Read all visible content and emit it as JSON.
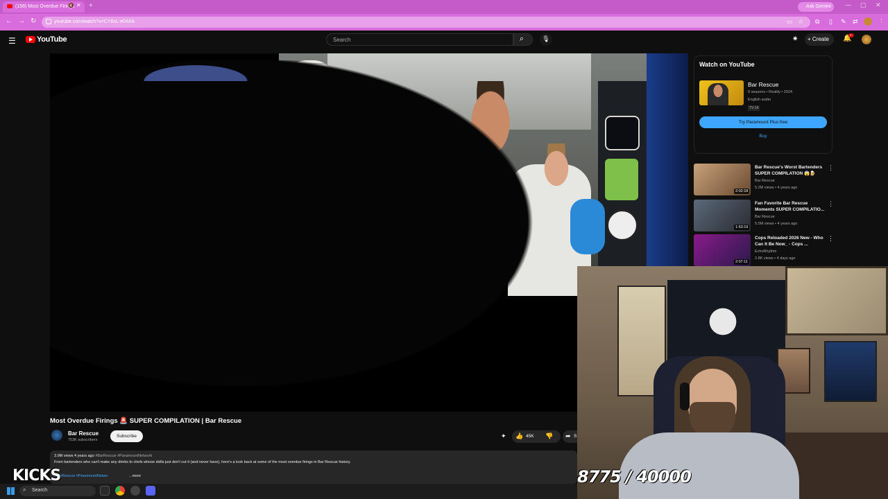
{
  "browser": {
    "tab_title": "(158) Most Overdue Firings",
    "mute_icon": "speaker-muted-icon",
    "gemini_label": "Ask Gemini",
    "url": "youtube.com/watch?v=CY8sL-e0AKk"
  },
  "header": {
    "logo_text": "YouTube",
    "search_placeholder": "Search",
    "create_label": "Create",
    "notifications_badge": "9+"
  },
  "watch_card": {
    "heading": "Watch on YouTube",
    "show_name": "Bar Rescue",
    "meta": "9 seasons • Reality • 2024",
    "audio": "English audio",
    "rating": "TV-14",
    "try_label": "Try Paramount Plus free",
    "buy_label": "Buy"
  },
  "related": [
    {
      "title": "Bar Rescue's Worst Bartenders SUPER COMPILATION 😱🍺",
      "channel": "Bar Rescue",
      "meta": "5.2M views • 4 years ago",
      "duration": "2:02:18"
    },
    {
      "title": "Fan Favorite Bar Rescue Moments SUPER COMPILATIO...",
      "channel": "Bar Rescue",
      "meta": "5.5M views • 4 years ago",
      "duration": "1:53:19"
    },
    {
      "title": "Cops Reloaded 2026 New - Who Can It Be Now_ - Cops ...",
      "channel": "EchoRhythm",
      "meta": "2.8K views • 4 days ago",
      "duration": "2:07:11"
    }
  ],
  "video": {
    "title": "Most Overdue Firings 🚨 SUPER COMPILATION | Bar Rescue",
    "channel": "Bar Rescue",
    "subscribers": "753K subscribers",
    "subscribe_label": "Subscribe",
    "likes": "45K",
    "share_label": "S"
  },
  "description": {
    "views_date": "3.9M views  4 years ago",
    "hashtags_top": "#BarRescue #ParamountNetwork",
    "text": "From bartenders who can't make any drinks to chefs whose skills just don't cut it (and never have), here's a look back at some of the most overdue firings in Bar Rescue history.",
    "hashtags_bottom": "#BarRescue #ParamountNetwo",
    "more": "...more"
  },
  "overlay": {
    "kicks": "KICKS",
    "counter": "8775 / 40000"
  },
  "taskbar": {
    "search_placeholder": "Search"
  }
}
